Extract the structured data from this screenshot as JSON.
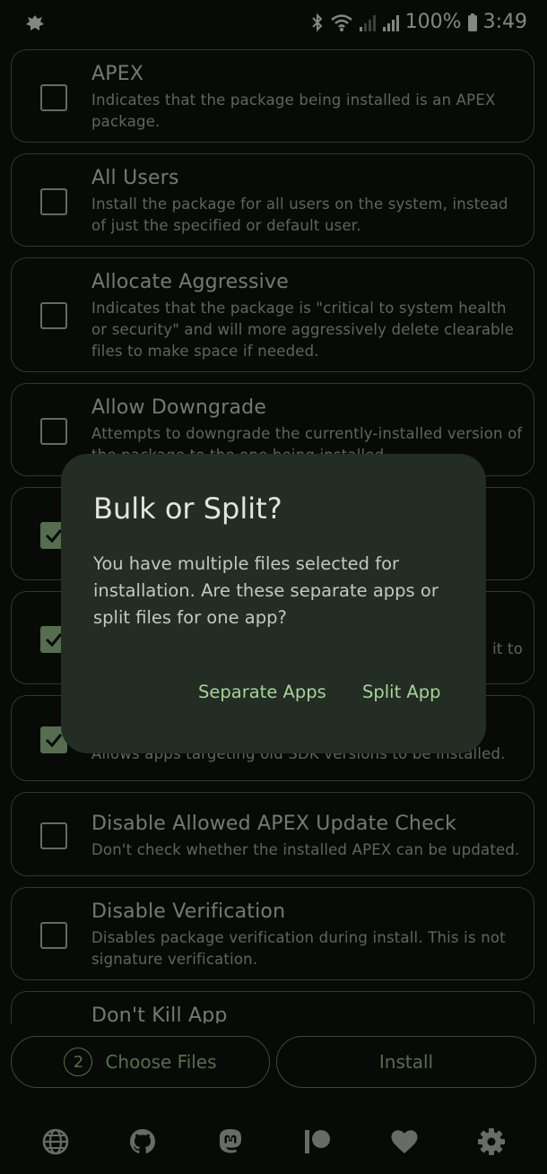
{
  "status_bar": {
    "battery_percent": "100%",
    "time": "3:49"
  },
  "options": [
    {
      "title": "APEX",
      "description": "Indicates that the package being installed is an APEX package.",
      "checked": false
    },
    {
      "title": "All Users",
      "description": "Install the package for all users on the system, instead of just the specified or default user.",
      "checked": false
    },
    {
      "title": "Allocate Aggressive",
      "description": "Indicates that the package is \"critical to system health or security\" and will more aggressively delete clearable files to make space if needed.",
      "checked": false
    },
    {
      "title": "Allow Downgrade",
      "description": "Attempts to downgrade the currently-installed version of the package to the one being installed.",
      "checked": false
    },
    {
      "title": "",
      "description": "",
      "checked": true
    },
    {
      "title": "",
      "description": "it to",
      "checked": true
    },
    {
      "title": "",
      "description": "Allows apps targeting old SDK versions to be installed.",
      "checked": true
    },
    {
      "title": "Disable Allowed APEX Update Check",
      "description": "Don't check whether the installed APEX can be updated.",
      "checked": false
    },
    {
      "title": "Disable Verification",
      "description": "Disables package verification during install. This is not signature verification.",
      "checked": false
    },
    {
      "title": "Don't Kill App",
      "description": "",
      "checked": false
    }
  ],
  "dialog": {
    "title": "Bulk or Split?",
    "message": "You have multiple files selected for installation. Are these separate apps or split files for one app?",
    "separate_label": "Separate Apps",
    "split_label": "Split App"
  },
  "actions": {
    "file_count": "2",
    "choose_files_label": "Choose Files",
    "install_label": "Install"
  },
  "nav_icons": [
    "globe-icon",
    "github-icon",
    "mastodon-icon",
    "patreon-icon",
    "heart-icon",
    "settings-icon"
  ],
  "colors": {
    "background": "#0f150f",
    "accent": "#a4d496",
    "dialog": "#232d24",
    "outline": "#5f6b5d"
  }
}
